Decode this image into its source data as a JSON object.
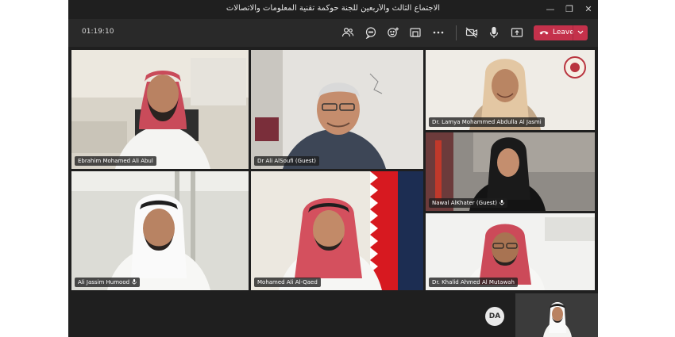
{
  "window": {
    "title": "الاجتماع الثالث والأربعين للجنة حوكمة تقنية المعلومات والاتصالات",
    "controls": {
      "minimize": "—",
      "restore": "❐",
      "close": "✕"
    }
  },
  "toolbar": {
    "timer": "01:19:10",
    "icons": [
      "people-icon",
      "chat-icon",
      "reactions-icon",
      "rooms-icon",
      "more-icon",
      "camera-off-icon",
      "microphone-icon",
      "share-icon"
    ],
    "leave_label": "Leave",
    "leave_color": "#c4314b"
  },
  "participants": [
    {
      "name": "Ebrahim Mohamed Ali Abul"
    },
    {
      "name": "Dr Ali AlSoufi (Guest)"
    },
    {
      "name": "Dr. Lamya Mohammed Abdulla Al Jasmi"
    },
    {
      "name": "Nawal AlKhater (Guest)"
    },
    {
      "name": "Ali Jassim Humood"
    },
    {
      "name": "Mohamed Ali Al-Qaed"
    },
    {
      "name": "Dr. Khalid Ahmed Al Mutawah"
    }
  ],
  "self": {
    "initials": "DA"
  }
}
